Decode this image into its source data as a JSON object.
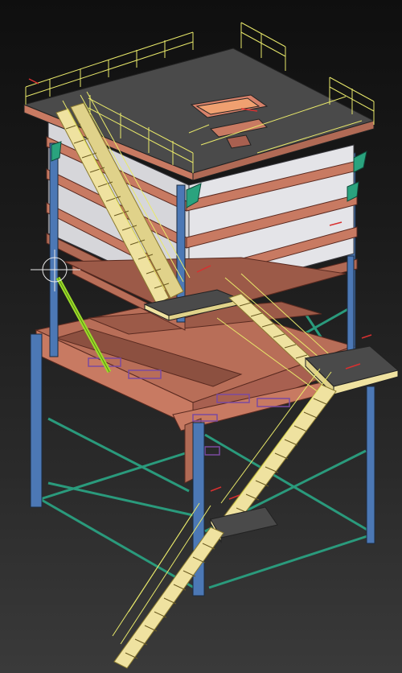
{
  "viewport": {
    "colors": {
      "steel_blue": "#4c78b5",
      "steel_salmon": "#c87a62",
      "panel_gray": "#d8d8dc",
      "deck_gray": "#4a4a4a",
      "brace_green": "#2a9a7c",
      "rail_yellow": "#e8e86a",
      "selected_green": "#9bdc2a",
      "axis_red": "#d83030"
    }
  }
}
